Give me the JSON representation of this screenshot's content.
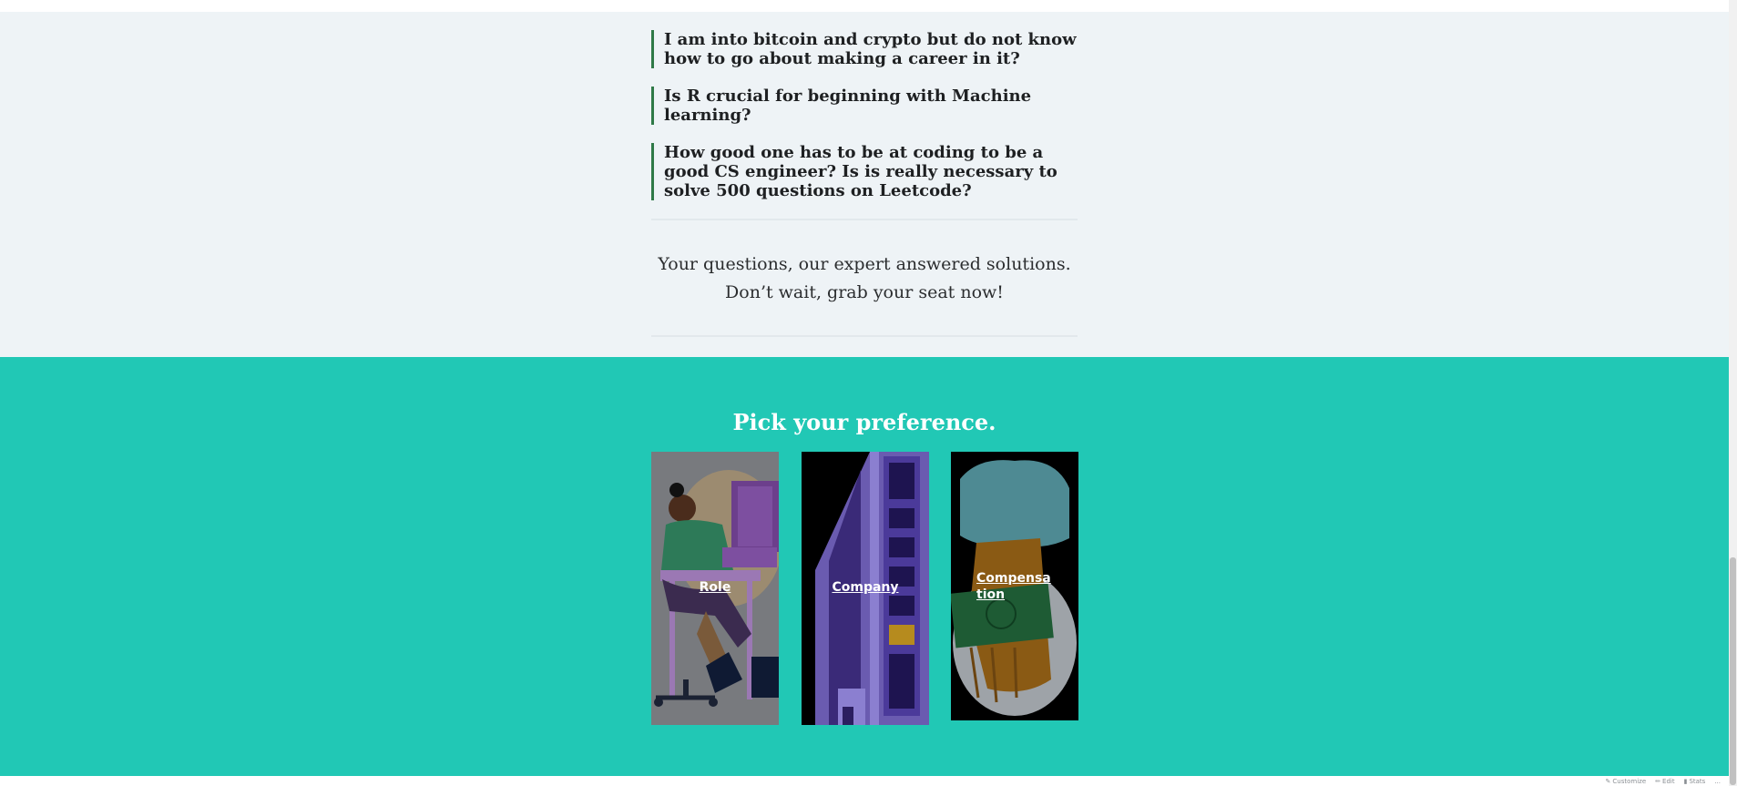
{
  "faq": {
    "items": [
      {
        "text": "I am into bitcoin and crypto but do not know how to go about making a career in it?"
      },
      {
        "text": "Is R crucial for beginning with Machine learning?"
      },
      {
        "text": "How good one has to be at coding to be a good CS engineer? Is is really necessary to solve 500 questions on Leetcode?"
      }
    ]
  },
  "cta": {
    "line1": "Your questions, our expert answered solutions.",
    "line2": "Don’t wait, grab your seat now!"
  },
  "preference": {
    "heading": "Pick your preference.",
    "cards": [
      {
        "label": "Role",
        "image_icon": "person-at-desk-illustration"
      },
      {
        "label": "Company",
        "image_icon": "building-illustration"
      },
      {
        "label": "Compensa tion",
        "image_icon": "money-in-hand-illustration"
      }
    ]
  },
  "admin_bar": {
    "items": [
      {
        "label": "Customize",
        "icon": "brush-icon"
      },
      {
        "label": "Edit",
        "icon": "pencil-icon"
      },
      {
        "label": "Stats",
        "icon": "bar-chart-icon"
      },
      {
        "label": "...",
        "icon": "more-icon"
      }
    ]
  },
  "colors": {
    "teal_section": "#21c8b5",
    "upper_section": "#eef3f6",
    "faq_border": "#2f7a47",
    "heading_text": "#ffffff"
  }
}
